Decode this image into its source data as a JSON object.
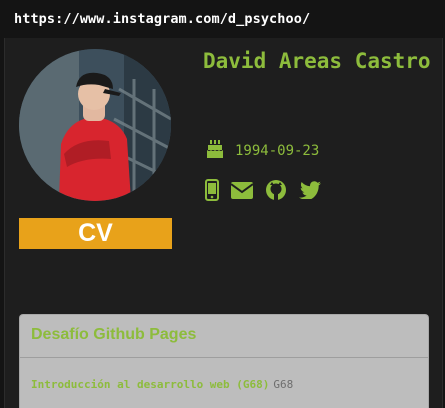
{
  "url": "https://www.instagram.com/d_psychoo/",
  "profile": {
    "name": "David Areas Castro",
    "birthdate": "1994-09-23",
    "cv_label": "CV"
  },
  "icons": {
    "birthday": "birthday-cake-icon",
    "social": [
      "mobile-phone-icon",
      "envelope-icon",
      "github-icon",
      "twitter-icon"
    ]
  },
  "colors": {
    "accent_green": "#8dbc3c",
    "cv_button": "#e8a21a",
    "background": "#1e1e1e",
    "panel": "#bdbdbd"
  },
  "panel": {
    "title": "Desafío Github Pages",
    "course_title": "Introducción al desarrollo web (G68)",
    "course_code": "G68"
  }
}
